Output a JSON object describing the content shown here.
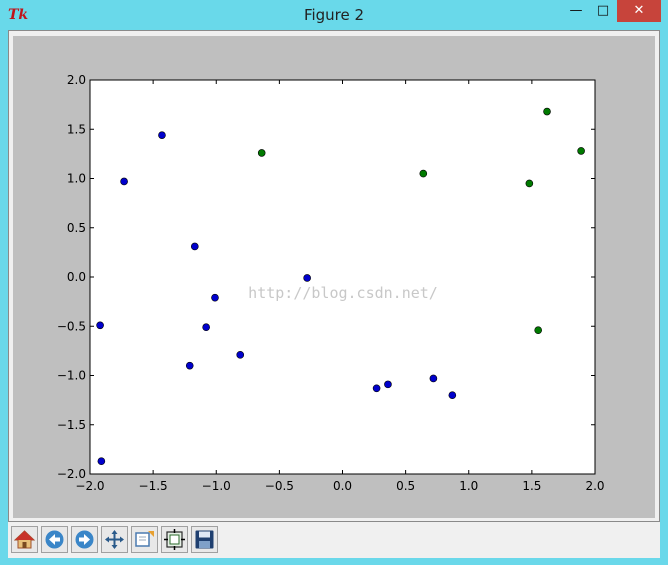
{
  "window": {
    "title": "Figure 2",
    "icon": "tk-icon",
    "controls": [
      "minimize-icon",
      "maximize-icon",
      "close-icon"
    ]
  },
  "watermark": "http://blog.csdn.net/",
  "toolbar": {
    "buttons": [
      {
        "name": "home-button",
        "icon": "home-icon"
      },
      {
        "name": "back-button",
        "icon": "arrow-left-icon"
      },
      {
        "name": "forward-button",
        "icon": "arrow-right-icon"
      },
      {
        "name": "pan-button",
        "icon": "move-icon"
      },
      {
        "name": "zoom-button",
        "icon": "zoom-rect-icon"
      },
      {
        "name": "subplots-button",
        "icon": "subplots-icon"
      },
      {
        "name": "save-button",
        "icon": "save-icon"
      }
    ]
  },
  "colors": {
    "titlebar": "#69d9ea",
    "figure_bg": "#bfbfbf",
    "series_blue": "#0000cc",
    "series_green": "#007a00",
    "close_button": "#c7443b"
  },
  "chart_data": {
    "type": "scatter",
    "title": "",
    "xlabel": "",
    "ylabel": "",
    "xlim": [
      -2.0,
      2.0
    ],
    "ylim": [
      -2.0,
      2.0
    ],
    "xticks": [
      -2.0,
      -1.5,
      -1.0,
      -0.5,
      0.0,
      0.5,
      1.0,
      1.5,
      2.0
    ],
    "yticks": [
      -2.0,
      -1.5,
      -1.0,
      -0.5,
      0.0,
      0.5,
      1.0,
      1.5,
      2.0
    ],
    "xtick_labels": [
      "−2.0",
      "−1.5",
      "−1.0",
      "−0.5",
      "0.0",
      "0.5",
      "1.0",
      "1.5",
      "2.0"
    ],
    "ytick_labels": [
      "−2.0",
      "−1.5",
      "−1.0",
      "−0.5",
      "0.0",
      "0.5",
      "1.0",
      "1.5",
      "2.0"
    ],
    "grid": false,
    "legend": "none",
    "series": [
      {
        "color": "#0000cc",
        "points": [
          {
            "x": -1.43,
            "y": 1.44
          },
          {
            "x": -1.73,
            "y": 0.97
          },
          {
            "x": -1.17,
            "y": 0.31
          },
          {
            "x": -1.01,
            "y": -0.21
          },
          {
            "x": -1.08,
            "y": -0.51
          },
          {
            "x": -1.92,
            "y": -0.49
          },
          {
            "x": -0.81,
            "y": -0.79
          },
          {
            "x": -1.21,
            "y": -0.9
          },
          {
            "x": -1.91,
            "y": -1.87
          },
          {
            "x": -0.28,
            "y": -0.01
          },
          {
            "x": 0.27,
            "y": -1.13
          },
          {
            "x": 0.36,
            "y": -1.09
          },
          {
            "x": 0.72,
            "y": -1.03
          },
          {
            "x": 0.87,
            "y": -1.2
          }
        ]
      },
      {
        "color": "#007a00",
        "points": [
          {
            "x": -0.64,
            "y": 1.26
          },
          {
            "x": 0.64,
            "y": 1.05
          },
          {
            "x": 1.48,
            "y": 0.95
          },
          {
            "x": 1.62,
            "y": 1.68
          },
          {
            "x": 1.89,
            "y": 1.28
          },
          {
            "x": 1.55,
            "y": -0.54
          }
        ]
      }
    ]
  }
}
